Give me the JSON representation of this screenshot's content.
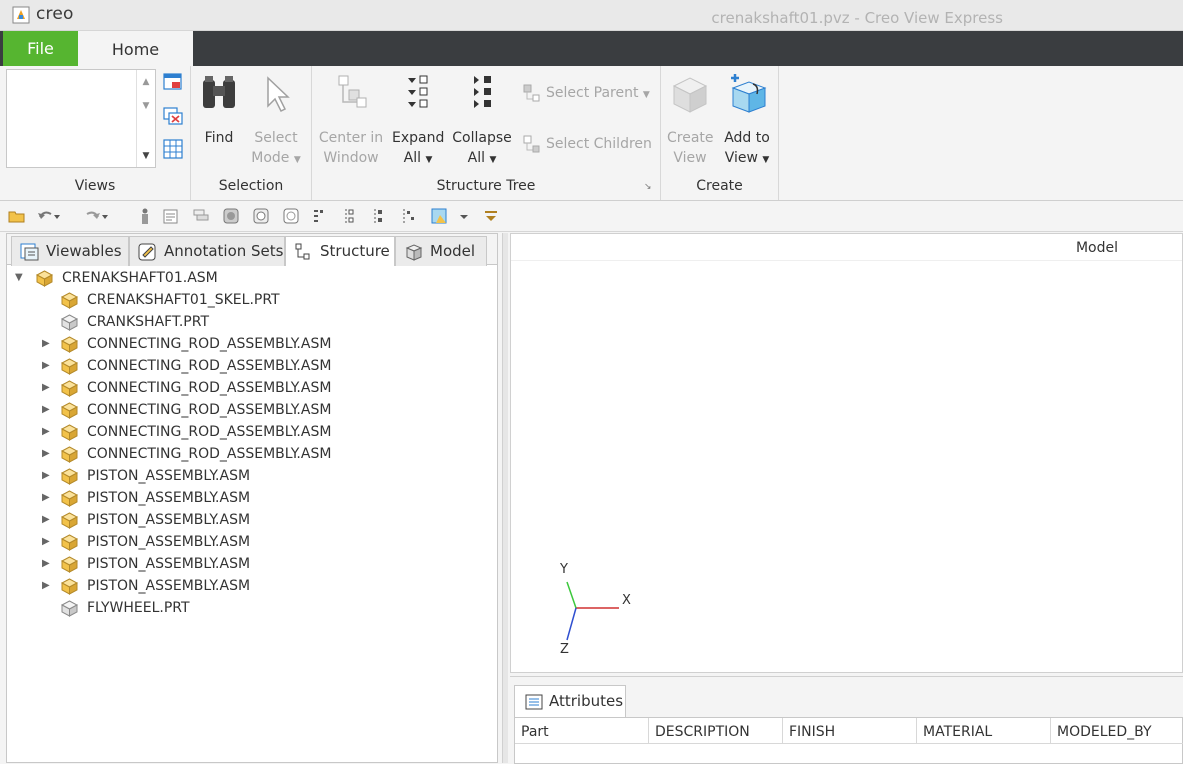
{
  "app": {
    "name": "creo",
    "window_title": "crenakshaft01.pvz - Creo View Express"
  },
  "ribbon_tabs": {
    "file": "File",
    "home": "Home"
  },
  "ribbon": {
    "views": {
      "label": "Views"
    },
    "selection": {
      "label": "Selection",
      "find": "Find",
      "select_mode_1": "Select",
      "select_mode_2": "Mode"
    },
    "structure_tree": {
      "label": "Structure Tree",
      "center_1": "Center in",
      "center_2": "Window",
      "expand_1": "Expand",
      "expand_2": "All",
      "collapse_1": "Collapse",
      "collapse_2": "All",
      "select_parent": "Select Parent",
      "select_children": "Select Children"
    },
    "create": {
      "label": "Create",
      "create_view_1": "Create",
      "create_view_2": "View",
      "add_to_view_1": "Add to",
      "add_to_view_2": "View"
    }
  },
  "panel_tabs": {
    "viewables": "Viewables",
    "annotation_sets": "Annotation Sets",
    "structure": "Structure",
    "model": "Model"
  },
  "tree": {
    "root": "CRENAKSHAFT01.ASM",
    "items": [
      {
        "label": "CRENAKSHAFT01_SKEL.PRT",
        "expandable": false,
        "icon": "yellow"
      },
      {
        "label": "CRANKSHAFT.PRT",
        "expandable": false,
        "icon": "grey"
      },
      {
        "label": "CONNECTING_ROD_ASSEMBLY.ASM",
        "expandable": true,
        "icon": "yellow"
      },
      {
        "label": "CONNECTING_ROD_ASSEMBLY.ASM",
        "expandable": true,
        "icon": "yellow"
      },
      {
        "label": "CONNECTING_ROD_ASSEMBLY.ASM",
        "expandable": true,
        "icon": "yellow"
      },
      {
        "label": "CONNECTING_ROD_ASSEMBLY.ASM",
        "expandable": true,
        "icon": "yellow"
      },
      {
        "label": "CONNECTING_ROD_ASSEMBLY.ASM",
        "expandable": true,
        "icon": "yellow"
      },
      {
        "label": "CONNECTING_ROD_ASSEMBLY.ASM",
        "expandable": true,
        "icon": "yellow"
      },
      {
        "label": "PISTON_ASSEMBLY.ASM",
        "expandable": true,
        "icon": "yellow"
      },
      {
        "label": "PISTON_ASSEMBLY.ASM",
        "expandable": true,
        "icon": "yellow"
      },
      {
        "label": "PISTON_ASSEMBLY.ASM",
        "expandable": true,
        "icon": "yellow"
      },
      {
        "label": "PISTON_ASSEMBLY.ASM",
        "expandable": true,
        "icon": "yellow"
      },
      {
        "label": "PISTON_ASSEMBLY.ASM",
        "expandable": true,
        "icon": "yellow"
      },
      {
        "label": "PISTON_ASSEMBLY.ASM",
        "expandable": true,
        "icon": "yellow"
      },
      {
        "label": "FLYWHEEL.PRT",
        "expandable": false,
        "icon": "grey"
      }
    ]
  },
  "viewport": {
    "label": "Model",
    "triad": {
      "x": "X",
      "y": "Y",
      "z": "Z"
    }
  },
  "attributes": {
    "tab": "Attributes",
    "columns": [
      "Part",
      "DESCRIPTION",
      "FINISH",
      "MATERIAL",
      "MODELED_BY"
    ]
  },
  "colors": {
    "file_tab": "#56b530",
    "tab_strip": "#3a3d40",
    "part_yellow": "#f2c24a",
    "part_grey": "#c9c9c9",
    "axis_x": "#d03030",
    "axis_y": "#3cc83c",
    "axis_z": "#2f4fd0"
  }
}
